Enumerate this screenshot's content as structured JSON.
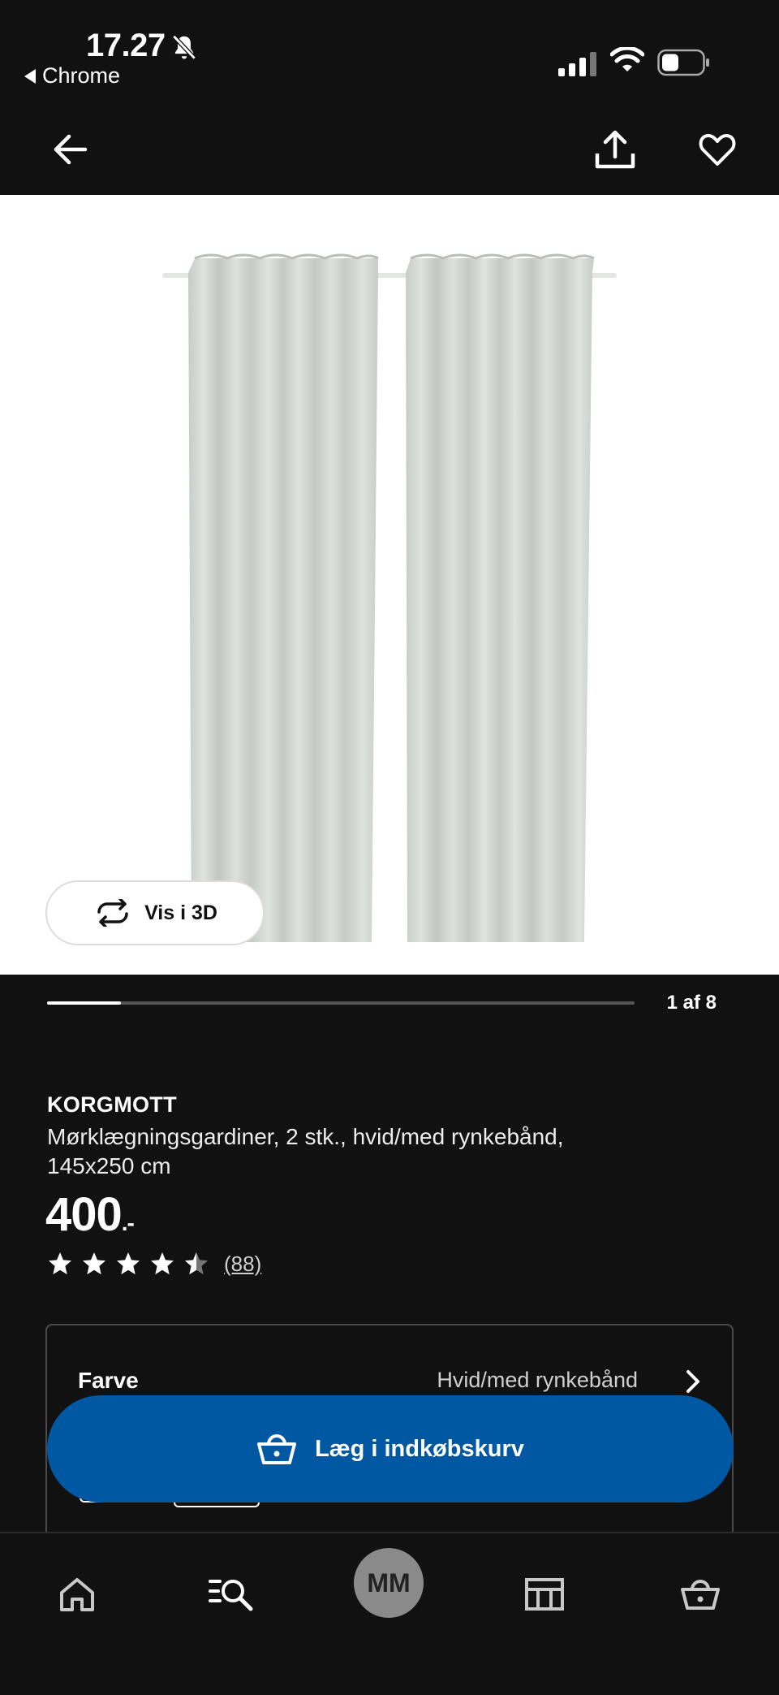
{
  "status_bar": {
    "time": "17.27",
    "back_app": "Chrome"
  },
  "header": {
    "back_icon": "arrow-left-icon",
    "share_icon": "share-icon",
    "favorite_icon": "heart-icon"
  },
  "gallery": {
    "view_3d_label": "Vis i 3D",
    "counter": "1 af 8",
    "current_index": 1,
    "total": 8
  },
  "product": {
    "brand": "KORGMOTT",
    "description": "Mørklægningsgardiner, 2 stk., hvid/med rynkebånd, 145x250 cm",
    "price": "400",
    "price_suffix": ".-",
    "rating_value": 4.5,
    "rating_max": 5,
    "review_count": "(88)"
  },
  "options": {
    "color_label": "Farve",
    "color_value": "Hvid/med rynkebånd"
  },
  "cta": {
    "add_to_cart_label": "Læg i indkøbskurv"
  },
  "bottom_nav": {
    "avatar_initials": "MM",
    "items": [
      "home-icon",
      "search-icon",
      "profile-avatar",
      "store-icon",
      "basket-icon"
    ]
  },
  "colors": {
    "background": "#111111",
    "primary_button": "#0058a3",
    "text": "#ffffff",
    "muted_text": "#cfcfcf"
  }
}
